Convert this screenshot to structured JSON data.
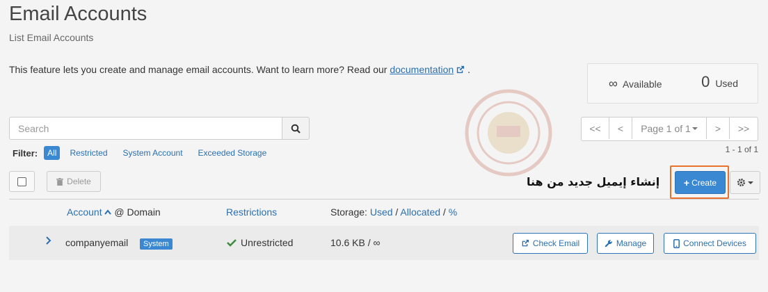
{
  "page": {
    "title": "Email Accounts",
    "subtitle": "List Email Accounts",
    "description": "This feature lets you create and manage email accounts. Want to learn more? Read our",
    "doc_link": "documentation",
    "desc_end": "."
  },
  "stats": {
    "available_symbol": "∞",
    "available_label": "Available",
    "used_count": "0",
    "used_label": "Used"
  },
  "search": {
    "placeholder": "Search",
    "icon": "search-icon"
  },
  "filter": {
    "label": "Filter:",
    "options": [
      "All",
      "Restricted",
      "System Account",
      "Exceeded Storage"
    ],
    "active": "All"
  },
  "pagination": {
    "first": "<<",
    "prev": "<",
    "current": "Page 1 of 1",
    "next": ">",
    "last": ">>",
    "range": "1 - 1 of 1"
  },
  "toolbar": {
    "delete_label": "Delete",
    "create_label": "Create",
    "annotation": "إنشاء إيميل جديد من هنا"
  },
  "table": {
    "headers": {
      "account": "Account",
      "at_domain": "@ Domain",
      "restrictions": "Restrictions",
      "storage_prefix": "Storage:",
      "storage_used": "Used",
      "storage_allocated": "Allocated",
      "storage_pct": "%",
      "sep": "/"
    },
    "rows": [
      {
        "account": "companyemail",
        "badge": "System",
        "restriction": "Unrestricted",
        "storage": "10.6 KB / ∞",
        "actions": [
          "Check Email",
          "Manage",
          "Connect Devices"
        ]
      }
    ]
  },
  "colors": {
    "primary": "#3a88d2",
    "link": "#2a6fb0",
    "highlight_outline": "#e8722b",
    "success": "#3c8a3c"
  }
}
